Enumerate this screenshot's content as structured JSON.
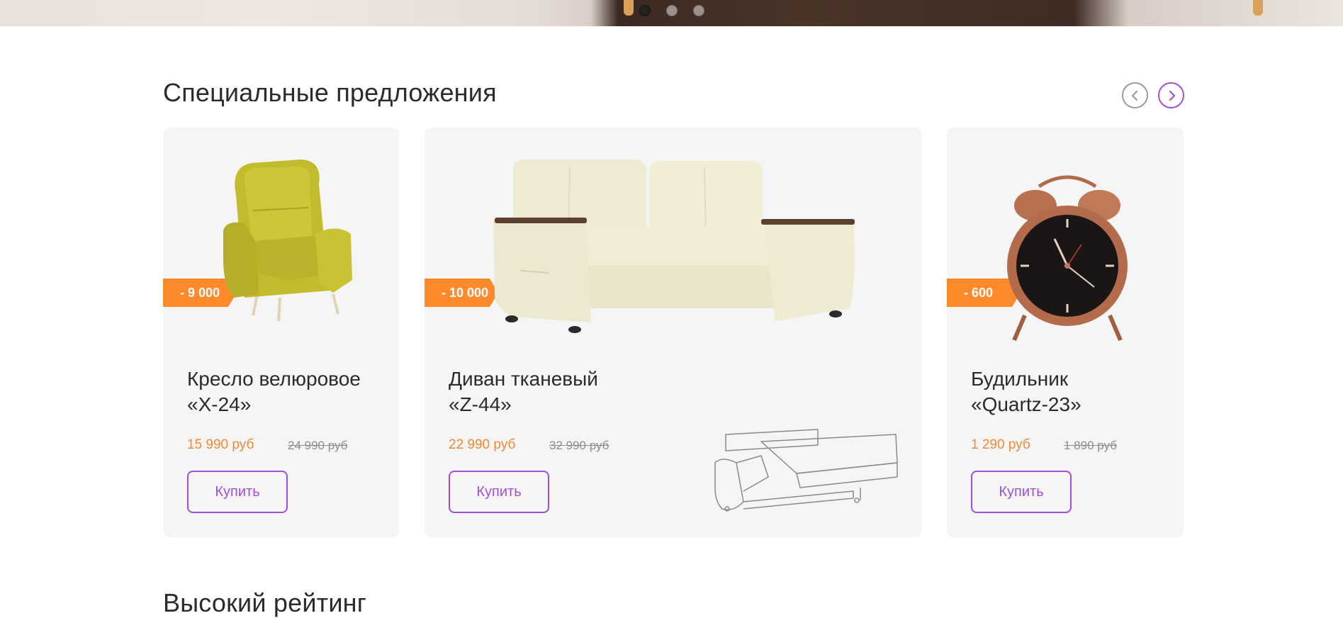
{
  "hero": {
    "slides": 3,
    "active_slide": 1
  },
  "special": {
    "title": "Специальные предложения",
    "products": [
      {
        "badge": "- 9 000",
        "name_line1": "Кресло велюровое",
        "name_line2": "«X-24»",
        "price": "15 990 руб",
        "old_price": "24 990 руб",
        "buy_label": "Купить"
      },
      {
        "badge": "- 10 000",
        "name_line1": "Диван тканевый",
        "name_line2": "«Z-44»",
        "price": "22 990 руб",
        "old_price": "32 990 руб",
        "buy_label": "Купить"
      },
      {
        "badge": "- 600",
        "name_line1": "Будильник",
        "name_line2": "«Quartz-23»",
        "price": "1 290 руб",
        "old_price": "1 890 руб",
        "buy_label": "Купить"
      }
    ]
  },
  "rating": {
    "title": "Высокий рейтинг"
  },
  "colors": {
    "accent": "#a24fd8",
    "price": "#f08a33",
    "badge": "#ff8a2b",
    "card_bg": "#f5f5f5"
  },
  "icons": {
    "prev": "chevron-left-icon",
    "next": "chevron-right-icon"
  }
}
